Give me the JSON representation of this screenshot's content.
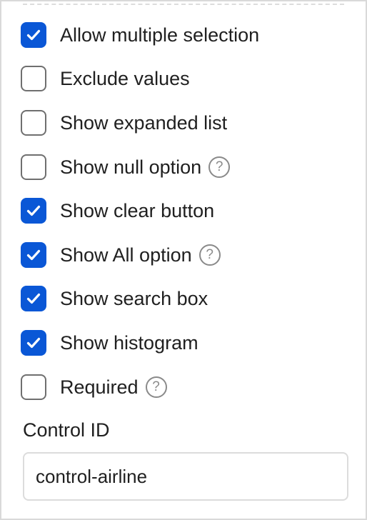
{
  "options": [
    {
      "label": "Allow multiple selection",
      "checked": true,
      "help": false
    },
    {
      "label": "Exclude values",
      "checked": false,
      "help": false
    },
    {
      "label": "Show expanded list",
      "checked": false,
      "help": false
    },
    {
      "label": "Show null option",
      "checked": false,
      "help": true
    },
    {
      "label": "Show clear button",
      "checked": true,
      "help": false
    },
    {
      "label": "Show All option",
      "checked": true,
      "help": true
    },
    {
      "label": "Show search box",
      "checked": true,
      "help": false
    },
    {
      "label": "Show histogram",
      "checked": true,
      "help": false
    },
    {
      "label": "Required",
      "checked": false,
      "help": true
    }
  ],
  "help_glyph": "?",
  "control_id": {
    "label": "Control ID",
    "value": "control-airline"
  },
  "colors": {
    "accent": "#0a57d6",
    "checkbox_border": "#6f6f6f",
    "text": "#202020"
  },
  "icons": {
    "check": "checkmark-icon",
    "help": "question-circle-icon"
  }
}
